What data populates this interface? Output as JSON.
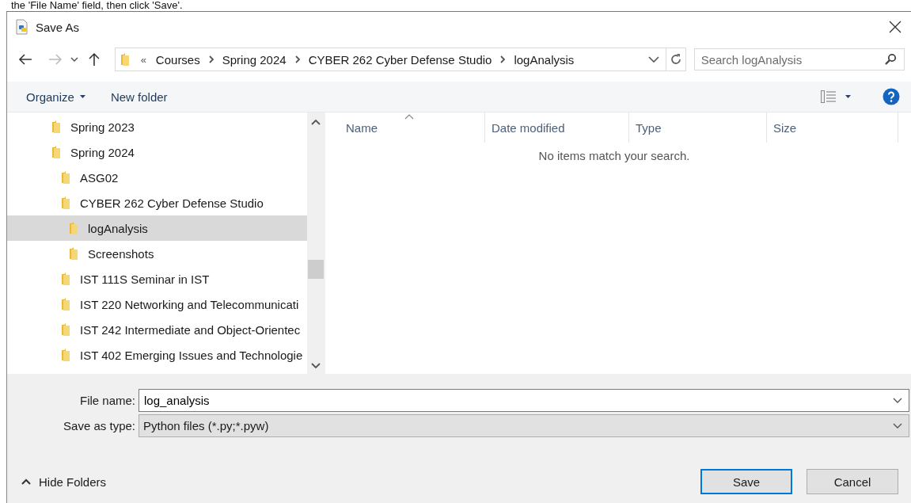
{
  "caption": "the 'File Name' field, then click 'Save'.",
  "window": {
    "title": "Save As"
  },
  "address_bar": {
    "overflow": "«",
    "path": [
      "Courses",
      "Spring 2024",
      "CYBER 262 Cyber Defense Studio",
      "logAnalysis"
    ]
  },
  "search": {
    "placeholder": "Search logAnalysis"
  },
  "toolbar": {
    "organize": "Organize",
    "new_folder": "New folder"
  },
  "tree": [
    {
      "label": "Spring 2023",
      "selected": false
    },
    {
      "label": "Spring 2024",
      "selected": false,
      "children": [
        {
          "label": "ASG02",
          "selected": false
        },
        {
          "label": "CYBER 262 Cyber Defense Studio",
          "selected": false,
          "children": [
            {
              "label": "logAnalysis",
              "selected": true
            },
            {
              "label": "Screenshots",
              "selected": false
            }
          ]
        },
        {
          "label": "IST 111S Seminar in IST",
          "selected": false
        },
        {
          "label": "IST 220 Networking and Telecommunicati",
          "selected": false
        },
        {
          "label": "IST 242 Intermediate and Object-Orientec",
          "selected": false
        },
        {
          "label": "IST 402 Emerging Issues and Technologie",
          "selected": false
        }
      ]
    }
  ],
  "columns": [
    {
      "label": "Name",
      "sorted": true
    },
    {
      "label": "Date modified",
      "sorted": false
    },
    {
      "label": "Type",
      "sorted": false
    },
    {
      "label": "Size",
      "sorted": false
    }
  ],
  "empty_message": "No items match your search.",
  "file_name": {
    "label": "File name:",
    "value": "log_analysis"
  },
  "save_as_type": {
    "label": "Save as type:",
    "value": "Python files (*.py;*.pyw)"
  },
  "hide_folders": "Hide Folders",
  "buttons": [
    {
      "label": "Save",
      "default": true
    },
    {
      "label": "Cancel",
      "default": false
    }
  ]
}
